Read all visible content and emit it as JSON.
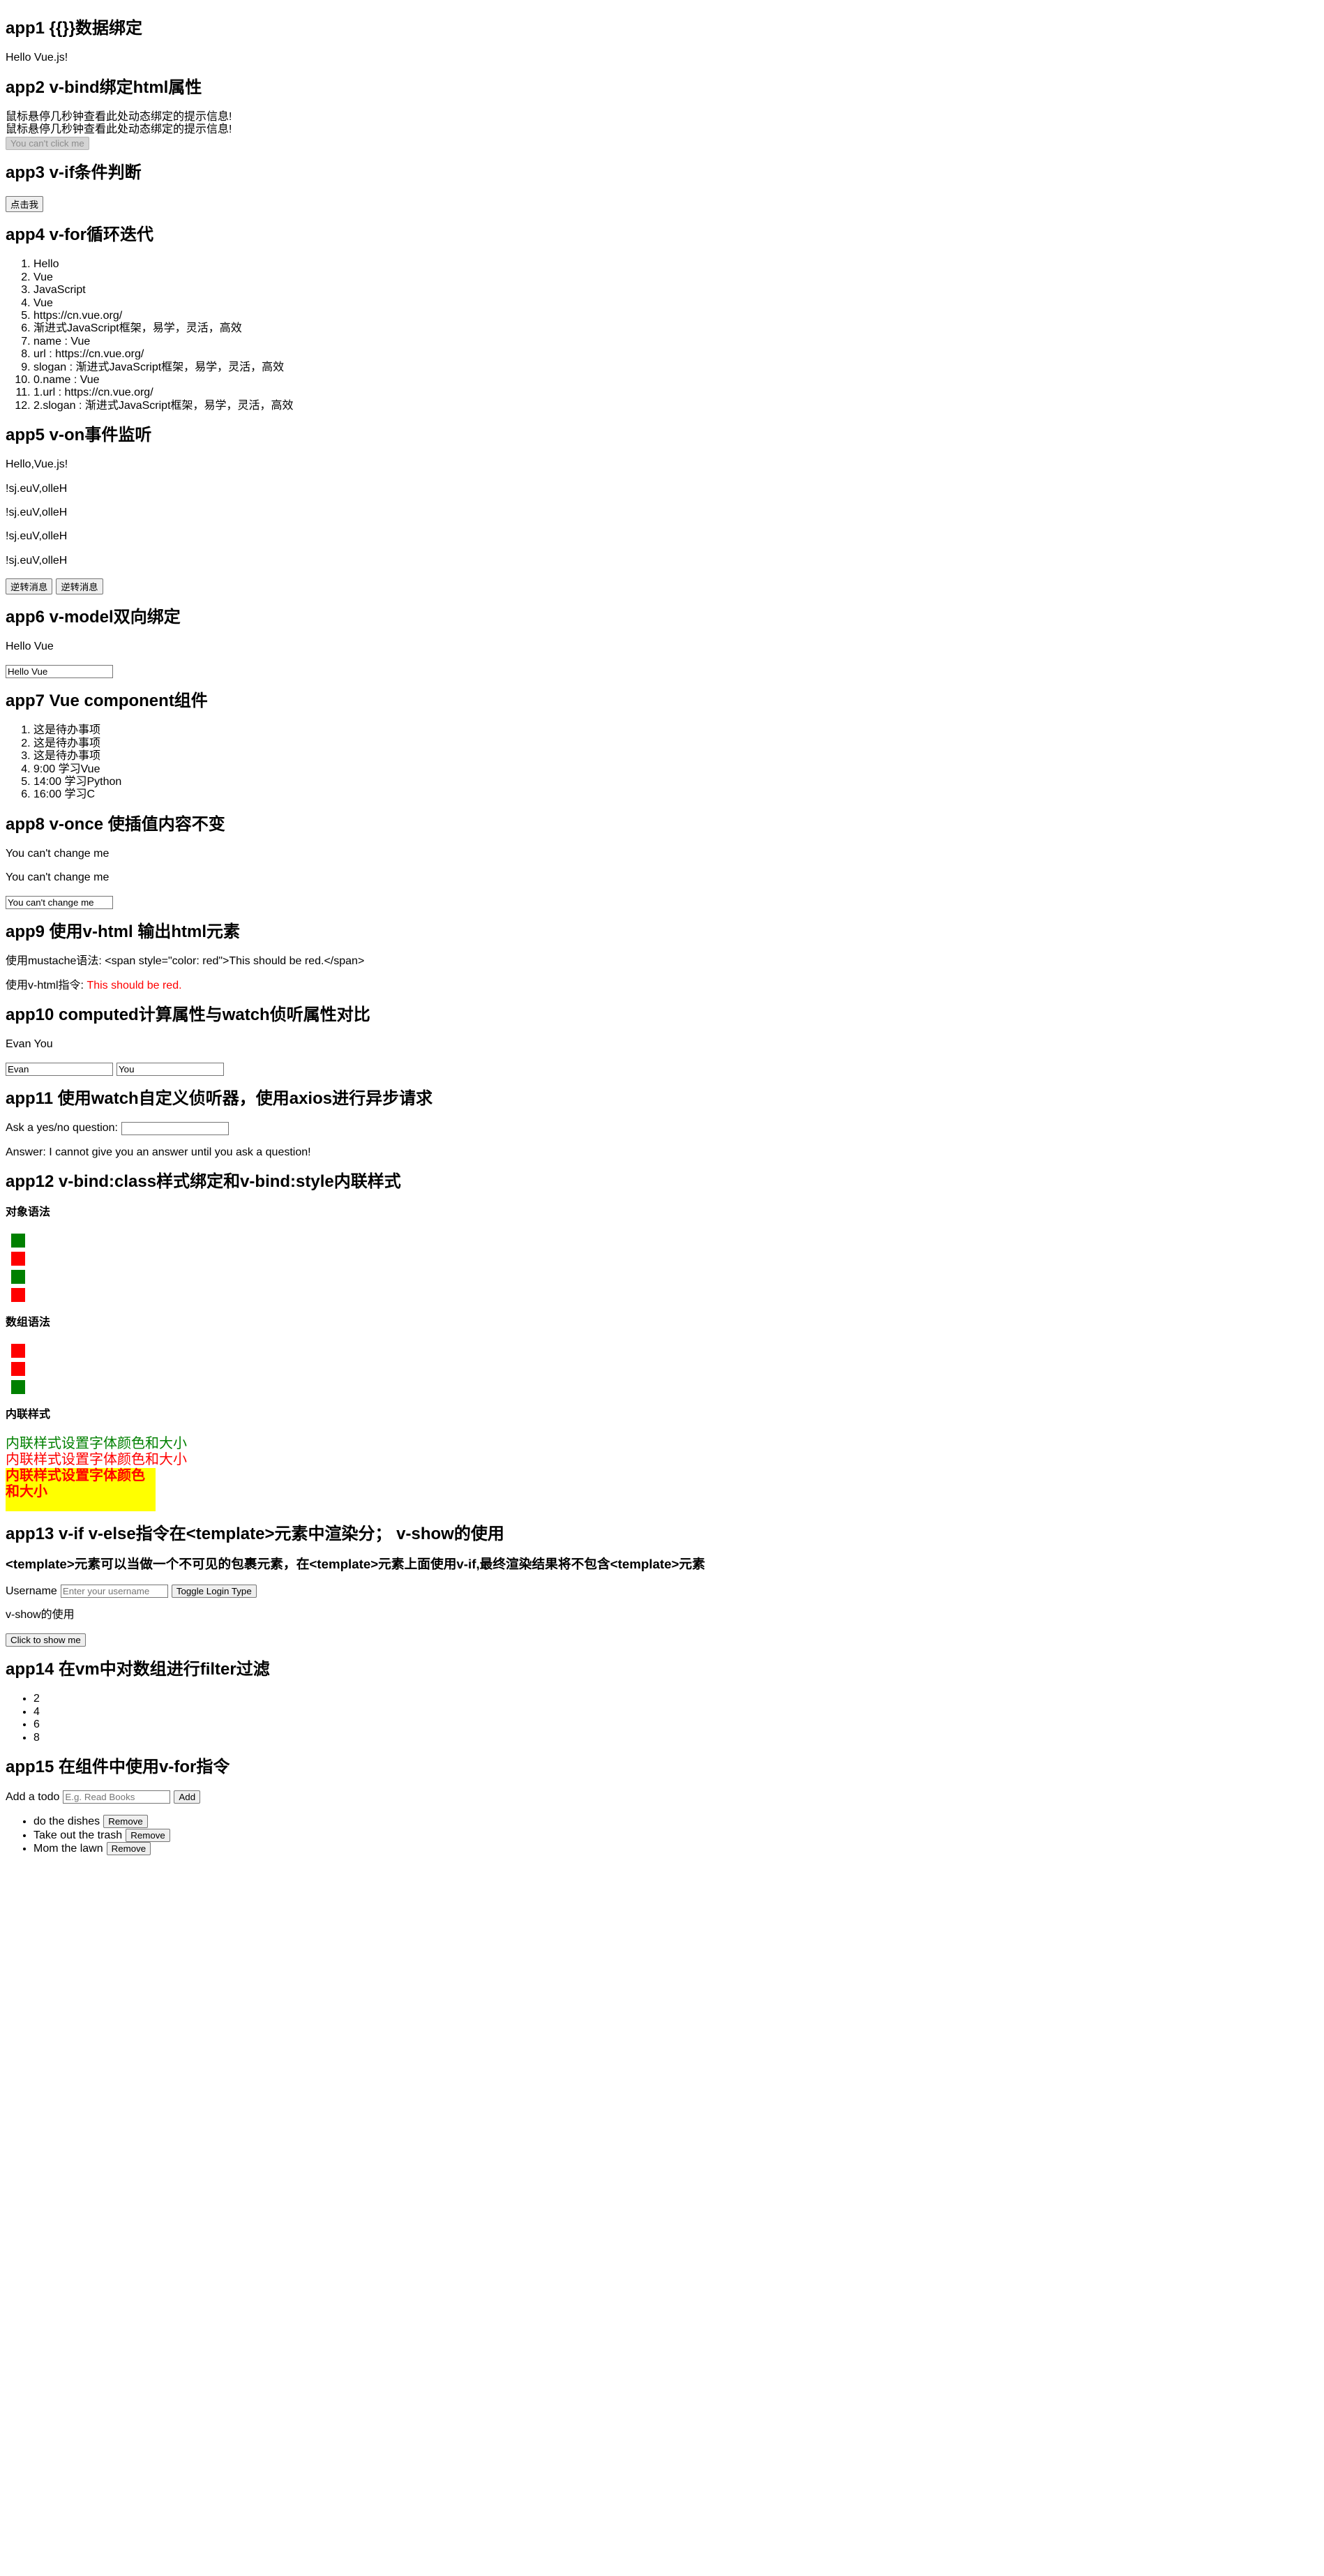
{
  "app1": {
    "heading": "app1 {{}}数据绑定",
    "message": "Hello Vue.js!"
  },
  "app2": {
    "heading": "app2 v-bind绑定html属性",
    "tooltip_line_1": "鼠标悬停几秒钟查看此处动态绑定的提示信息!",
    "tooltip_line_2": "鼠标悬停几秒钟查看此处动态绑定的提示信息!",
    "disabled_button_label": "You can't click me"
  },
  "app3": {
    "heading": "app3 v-if条件判断",
    "button_label": "点击我"
  },
  "app4": {
    "heading": "app4 v-for循环迭代",
    "items": [
      "Hello",
      "Vue",
      "JavaScript",
      "Vue",
      "https://cn.vue.org/",
      "渐进式JavaScript框架，易学，灵活，高效",
      "name : Vue",
      "url : https://cn.vue.org/",
      "slogan : 渐进式JavaScript框架，易学，灵活，高效",
      "0.name : Vue",
      "1.url : https://cn.vue.org/",
      "2.slogan : 渐进式JavaScript框架，易学，灵活，高效"
    ]
  },
  "app5": {
    "heading": "app5 v-on事件监听",
    "original": "Hello,Vue.js!",
    "reversed_1": "!sj.euV,olleH",
    "reversed_2": "!sj.euV,olleH",
    "reversed_3": "!sj.euV,olleH",
    "reversed_4": "!sj.euV,olleH",
    "button_1_label": "逆转消息",
    "button_2_label": "逆转消息"
  },
  "app6": {
    "heading": "app6 v-model双向绑定",
    "text": "Hello Vue",
    "input_value": "Hello Vue"
  },
  "app7": {
    "heading": "app7 Vue component组件",
    "items": [
      "这是待办事项",
      "这是待办事项",
      "这是待办事项",
      "9:00 学习Vue",
      "14:00 学习Python",
      "16:00 学习C"
    ]
  },
  "app8": {
    "heading": "app8 v-once 使插值内容不变",
    "line_1": "You can't change me",
    "line_2": "You can't change me",
    "input_value": "You can't change me"
  },
  "app9": {
    "heading": "app9 使用v-html 输出html元素",
    "mustache_line": "使用mustache语法: <span style=\"color: red\">This should be red.</span>",
    "vhtml_prefix": "使用v-html指令: ",
    "vhtml_rendered": "This should be red.",
    "vhtml_color": "#ff0000"
  },
  "app10": {
    "heading": "app10 computed计算属性与watch侦听属性对比",
    "full_name": "Evan You",
    "first_name": "Evan",
    "last_name": "You"
  },
  "app11": {
    "heading": "app11 使用watch自定义侦听器，使用axios进行异步请求",
    "question_label": "Ask a yes/no question:",
    "question_value": "",
    "answer": "Answer: I cannot give you an answer until you ask a question!"
  },
  "app12": {
    "heading": "app12 v-bind:class样式绑定和v-bind:style内联样式",
    "object_syntax_heading": "对象语法",
    "object_syntax_swatches": [
      "#008000",
      "#ff0000",
      "#008000",
      "#ff0000"
    ],
    "array_syntax_heading": "数组语法",
    "array_syntax_swatches": [
      "#ff0000",
      "#ff0000",
      "#008000"
    ],
    "inline_style_heading": "内联样式",
    "inline_rows": [
      {
        "text": "内联样式设置字体颜色和大小",
        "color": "#008000"
      },
      {
        "text": "内联样式设置字体颜色和大小",
        "color": "#ff0000"
      },
      {
        "text": "内联样式设置字体颜色和大小",
        "color": "#ff0000",
        "background": "#ffff00"
      }
    ]
  },
  "app13": {
    "heading": "app13 v-if v-else指令在<template>元素中渲染分； v-show的使用",
    "template_note": "<template>元素可以当做一个不可见的包裹元素，在<template>元素上面使用v-if,最终渲染结果将不包含<template>元素",
    "username_label": "Username",
    "username_placeholder": "Enter your username",
    "username_value": "",
    "toggle_button_label": "Toggle Login Type",
    "vshow_label": "v-show的使用",
    "vshow_button_label": "Click to show me"
  },
  "app14": {
    "heading": "app14 在vm中对数组进行filter过滤",
    "items": [
      "2",
      "4",
      "6",
      "8"
    ]
  },
  "app15": {
    "heading": "app15 在组件中使用v-for指令",
    "add_label": "Add a todo",
    "add_placeholder": "E.g. Read Books",
    "add_value": "",
    "add_button_label": "Add",
    "todos": [
      {
        "text": "do the dishes",
        "remove_label": "Remove"
      },
      {
        "text": "Take out the trash",
        "remove_label": "Remove"
      },
      {
        "text": "Mom the lawn",
        "remove_label": "Remove"
      }
    ]
  }
}
